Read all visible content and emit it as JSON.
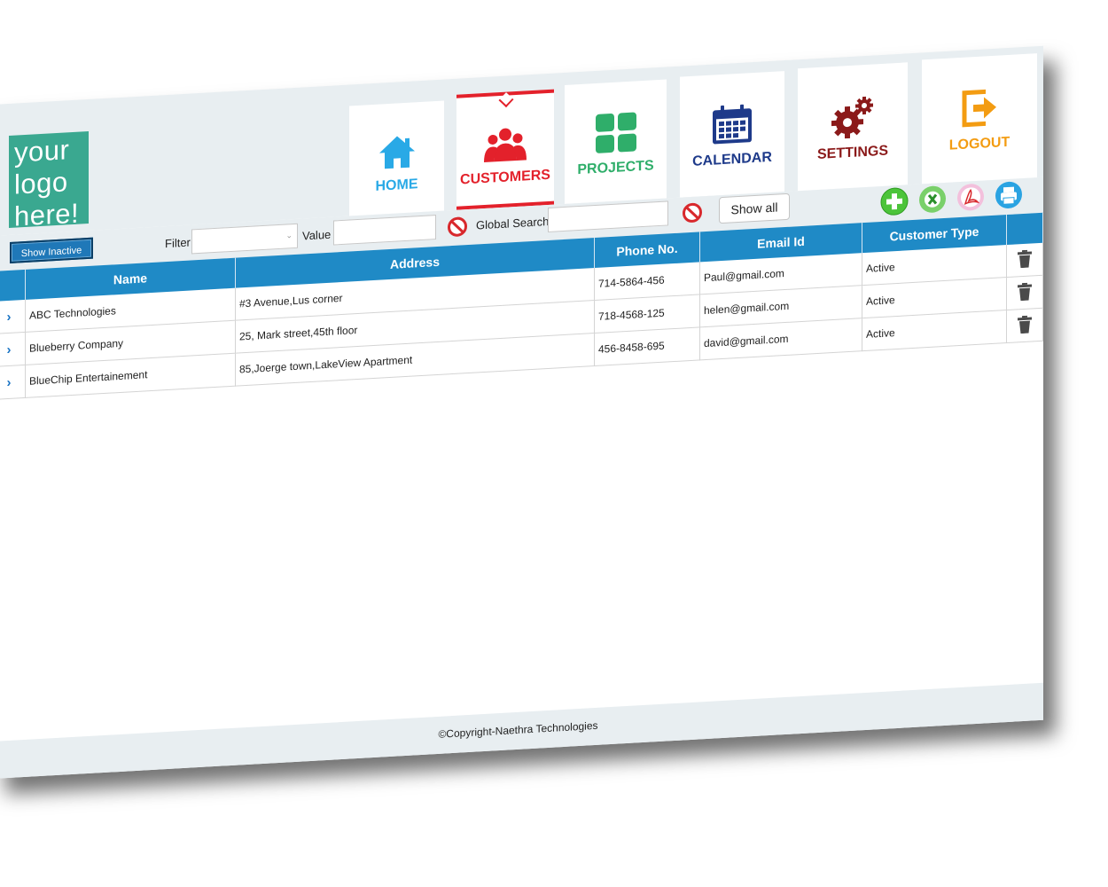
{
  "logo": {
    "lines": [
      "your",
      "logo",
      "here!"
    ]
  },
  "nav": {
    "items": [
      {
        "label": "HOME",
        "icon": "home-icon",
        "color": "#29a9e6"
      },
      {
        "label": "CUSTOMERS",
        "icon": "users-icon",
        "color": "#e3212b",
        "active": true
      },
      {
        "label": "PROJECTS",
        "icon": "grid-icon",
        "color": "#2fae6a"
      },
      {
        "label": "CALENDAR",
        "icon": "calendar-icon",
        "color": "#1e3a8a"
      },
      {
        "label": "SETTINGS",
        "icon": "gears-icon",
        "color": "#8b1a1a"
      },
      {
        "label": "LOGOUT",
        "icon": "logout-icon",
        "color": "#f39c12"
      }
    ]
  },
  "toolbar": {
    "show_inactive": "Show Inactive",
    "filter_label": "Filter",
    "filter_value": "",
    "value_label": "Value",
    "value_input": "",
    "global_search_label": "Global Search",
    "global_search_value": "",
    "show_all": "Show all",
    "actions": [
      "add-icon",
      "excel-icon",
      "pdf-icon",
      "print-icon"
    ]
  },
  "table": {
    "columns": [
      "",
      "Name",
      "Address",
      "Phone No.",
      "Email Id",
      "Customer Type",
      ""
    ],
    "rows": [
      {
        "name": "ABC Technologies",
        "address": "#3 Avenue,Lus corner",
        "phone": "714-5864-456",
        "email": "Paul@gmail.com",
        "type": "Active"
      },
      {
        "name": "Blueberry Company",
        "address": "25, Mark street,45th floor",
        "phone": "718-4568-125",
        "email": "helen@gmail.com",
        "type": "Active"
      },
      {
        "name": "BlueChip Entertainement",
        "address": "85,Joerge town,LakeView Apartment",
        "phone": "456-8458-695",
        "email": "david@gmail.com",
        "type": "Active"
      }
    ]
  },
  "footer": {
    "text": "©Copyright-Naethra Technologies"
  },
  "colors": {
    "header_blue": "#1f8ac6",
    "active_red": "#e3212b",
    "bar_bg": "#e8eef1",
    "logo_green": "#3aa890"
  }
}
